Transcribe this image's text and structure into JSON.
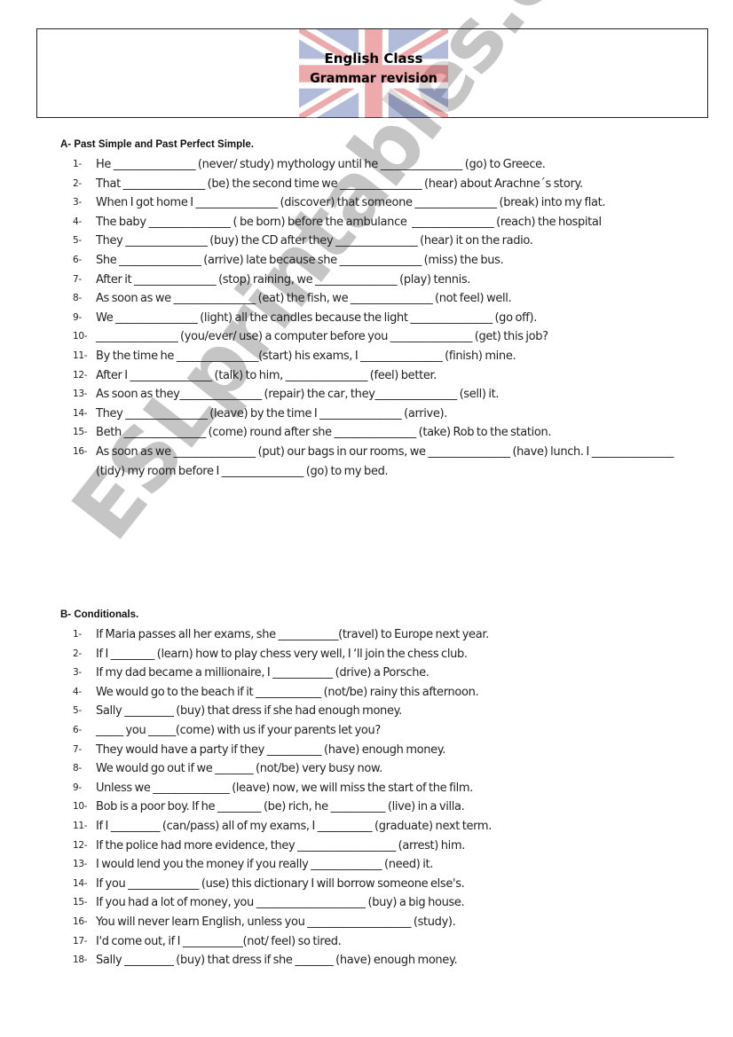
{
  "header": {
    "title": "English Class",
    "subtitle": "Grammar revision",
    "background_image": "uk-flag-faded"
  },
  "watermark": "ESLprintables.com",
  "sections": [
    {
      "heading": "A- Past Simple and Past Perfect Simple.",
      "items": [
        {
          "num": "1-",
          "text": "He _______________ (never/ study) mythology until he _______________ (go) to Greece."
        },
        {
          "num": "2-",
          "text": "That _______________ (be) the second time we _______________ (hear) about Arachne´s story."
        },
        {
          "num": "3-",
          "text": "When I got home I _______________ (discover) that someone _______________ (break) into my flat."
        },
        {
          "num": "4-",
          "text": "The baby _______________ ( be born) before the ambulance  _______________ (reach) the hospital"
        },
        {
          "num": "5-",
          "text": "They _______________ (buy) the CD after they _______________ (hear) it on the radio."
        },
        {
          "num": "6-",
          "text": "She _______________ (arrive) late because she _______________ (miss) the bus."
        },
        {
          "num": "7-",
          "text": "After it _______________ (stop) raining, we _______________ (play) tennis."
        },
        {
          "num": "8-",
          "text": "As soon as we _______________ (eat) the fish, we _______________ (not feel) well."
        },
        {
          "num": "9-",
          "text": "We _______________ (light) all the candles because the light _______________ (go off)."
        },
        {
          "num": "10-",
          "text": "_______________ (you/ever/ use) a computer before you _______________ (get) this job?"
        },
        {
          "num": "11-",
          "text": "By the time he _______________(start) his exams, I _______________ (finish) mine."
        },
        {
          "num": "12-",
          "text": "After I _______________ (talk) to him, _______________ (feel) better."
        },
        {
          "num": "13-",
          "text": "As soon as they_______________ (repair) the car, they_______________ (sell) it."
        },
        {
          "num": "14-",
          "text": "They _______________ (leave) by the time I _______________ (arrive)."
        },
        {
          "num": "15-",
          "text": "Beth _______________ (come) round after she _______________ (take) Rob to the station."
        },
        {
          "num": "16-",
          "text": "As soon as we _______________ (put) our bags in our rooms, we _______________ (have) lunch. I _______________ (tidy) my room before I _______________ (go) to my bed."
        }
      ]
    },
    {
      "heading": "B- Conditionals.",
      "items": [
        {
          "num": "1-",
          "text": "If Maria passes all her exams, she ___________(travel) to Europe next year."
        },
        {
          "num": "2-",
          "text": "If I ________ (learn) how to play chess very well, I ‘ll join the chess club."
        },
        {
          "num": "3-",
          "text": "If my dad became a millionaire, I ___________ (drive) a Porsche."
        },
        {
          "num": "4-",
          "text": "We would go to the beach if it ____________ (not/be) rainy this afternoon."
        },
        {
          "num": "5-",
          "text": "Sally _________ (buy) that dress if she had enough money."
        },
        {
          "num": "6-",
          "text": "_____ you _____(come) with us if your parents let you?"
        },
        {
          "num": "7-",
          "text": "They would have a party if they __________ (have) enough money."
        },
        {
          "num": "8-",
          "text": "We would go out if we _______ (not/be) very busy now."
        },
        {
          "num": "9-",
          "text": "Unless we ______________ (leave) now, we will miss the start of the film."
        },
        {
          "num": "10-",
          "text": "Bob is a poor boy. If he ________ (be) rich, he __________ (live) in a villa."
        },
        {
          "num": "11-",
          "text": "If I _________ (can/pass) all of my exams, I __________ (graduate) next term."
        },
        {
          "num": "12-",
          "text": "If the police had more evidence, they __________________ (arrest) him."
        },
        {
          "num": "13-",
          "text": "I would lend you the money if you really _____________ (need) it."
        },
        {
          "num": "14-",
          "text": "If you _____________ (use) this dictionary I will borrow someone else's."
        },
        {
          "num": "15-",
          "text": "If you had a lot of money, you ____________________ (buy) a big house."
        },
        {
          "num": "16-",
          "text": "You will never learn English, unless you ___________________ (study)."
        },
        {
          "num": "17-",
          "text": "I'd come out, if I ___________(not/ feel) so tired."
        },
        {
          "num": "18-",
          "text": "Sally _________ (buy) that dress if she _______ (have) enough money."
        }
      ]
    }
  ]
}
